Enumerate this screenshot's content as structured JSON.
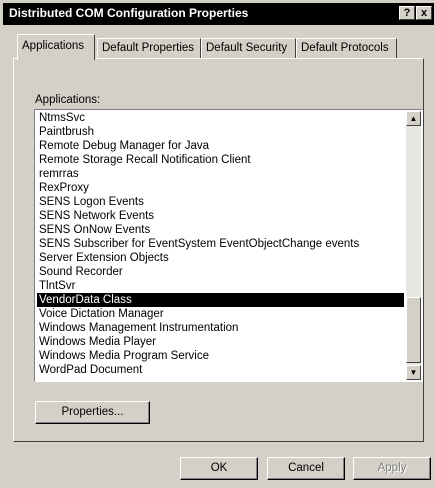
{
  "window": {
    "title": "Distributed COM Configuration Properties",
    "help_glyph": "?",
    "close_glyph": "x"
  },
  "tabs": [
    {
      "label": "Applications",
      "active": true
    },
    {
      "label": "Default Properties",
      "active": false
    },
    {
      "label": "Default Security",
      "active": false
    },
    {
      "label": "Default Protocols",
      "active": false
    }
  ],
  "applications": {
    "label": "Applications:",
    "items": [
      "NtmsSvc",
      "Paintbrush",
      "Remote Debug Manager for Java",
      "Remote Storage Recall Notification Client",
      "remrras",
      "RexProxy",
      "SENS Logon Events",
      "SENS Network Events",
      "SENS OnNow Events",
      "SENS Subscriber for EventSystem EventObjectChange events",
      "Server Extension Objects",
      "Sound Recorder",
      "TlntSvr",
      "VendorData Class",
      "Voice Dictation Manager",
      "Windows Management Instrumentation",
      "Windows Media Player",
      "Windows Media Program Service",
      "WordPad Document"
    ],
    "selected_index": 13
  },
  "buttons": {
    "properties": "Properties...",
    "ok": "OK",
    "cancel": "Cancel",
    "apply": "Apply"
  }
}
